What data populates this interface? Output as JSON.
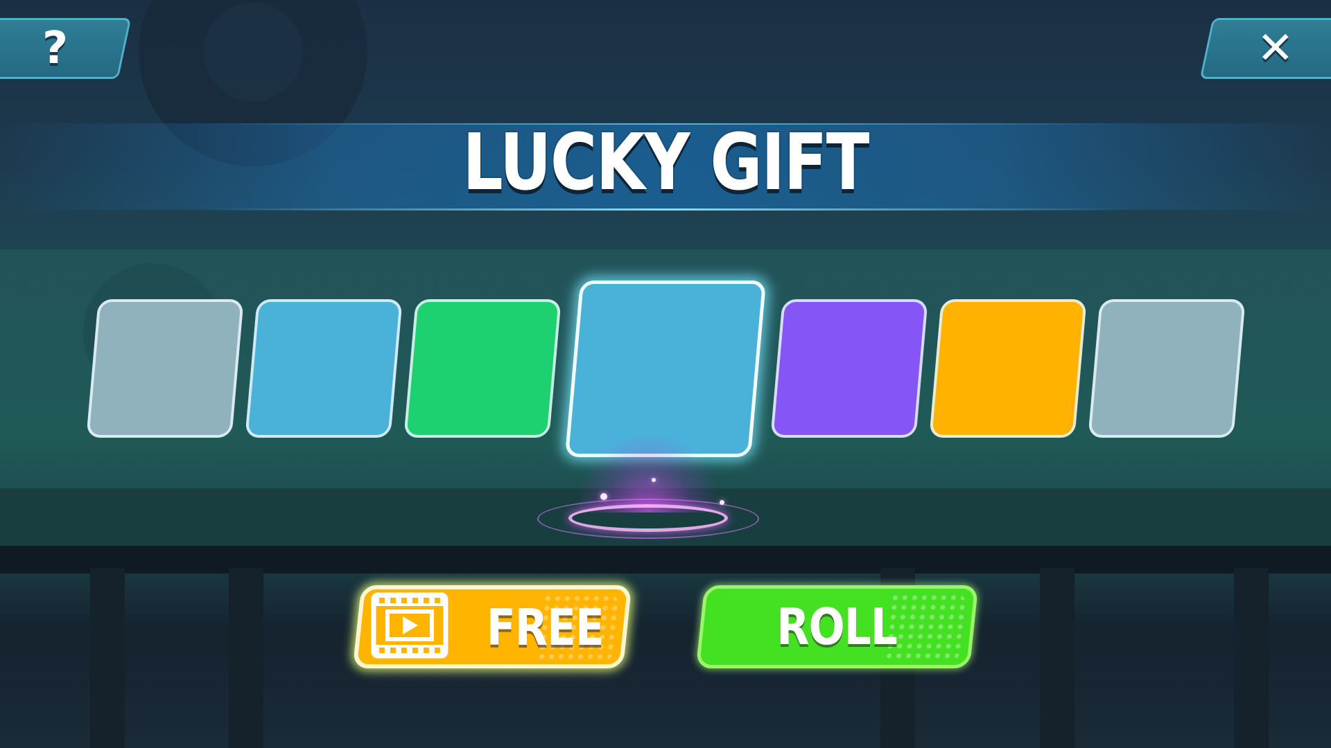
{
  "header": {
    "title": "LUCKY GIFT"
  },
  "corner_buttons": {
    "help": {
      "glyph": "?",
      "icon": "question-icon"
    },
    "close": {
      "glyph": "✕",
      "icon": "close-icon"
    }
  },
  "slots": [
    {
      "color": "#8fb2bc",
      "active": false
    },
    {
      "color": "#4ab1d9",
      "active": false
    },
    {
      "color": "#1ed170",
      "active": false
    },
    {
      "color": "#4ab1d9",
      "active": true
    },
    {
      "color": "#8555f6",
      "active": false
    },
    {
      "color": "#ffb300",
      "active": false
    },
    {
      "color": "#8fb2bc",
      "active": false
    }
  ],
  "actions": {
    "free_label": "FREE",
    "free_icon": "video-play-icon",
    "roll_label": "ROLL"
  },
  "colors": {
    "free_button": "#ffb400",
    "roll_button": "#44e022",
    "title_band": "#1f6aa6"
  }
}
